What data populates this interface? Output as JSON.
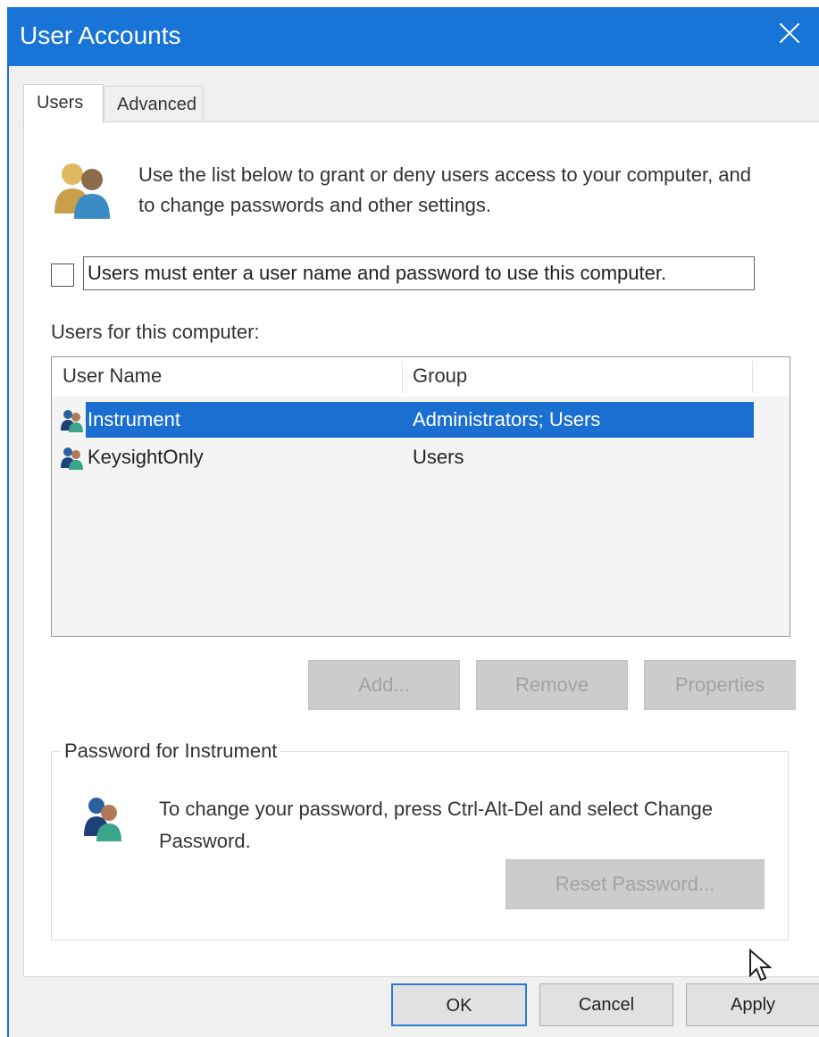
{
  "window": {
    "title": "User Accounts"
  },
  "tabs": [
    {
      "label": "Users",
      "active": true
    },
    {
      "label": "Advanced",
      "active": false
    }
  ],
  "intro": {
    "text": "Use the list below to grant or deny users access to your computer, and to change passwords and other settings.",
    "icon": "users-group-icon"
  },
  "checkbox": {
    "label": "Users must enter a user name and password to use this computer.",
    "checked": false
  },
  "users_label": "Users for this computer:",
  "table": {
    "columns": [
      "User Name",
      "Group"
    ],
    "rows": [
      {
        "name": "Instrument",
        "group": "Administrators; Users",
        "selected": true
      },
      {
        "name": "KeysightOnly",
        "group": "Users",
        "selected": false
      }
    ]
  },
  "buttons": {
    "add": "Add...",
    "remove": "Remove",
    "properties": "Properties"
  },
  "password_group": {
    "title": "Password for Instrument",
    "text": "To change your password, press Ctrl-Alt-Del and select Change Password.",
    "reset": "Reset Password..."
  },
  "dialog_buttons": {
    "ok": "OK",
    "cancel": "Cancel",
    "apply": "Apply"
  },
  "colors": {
    "title_bar": "#1874d6",
    "selection": "#1b6fd0",
    "disabled_button": "#cccccc"
  }
}
